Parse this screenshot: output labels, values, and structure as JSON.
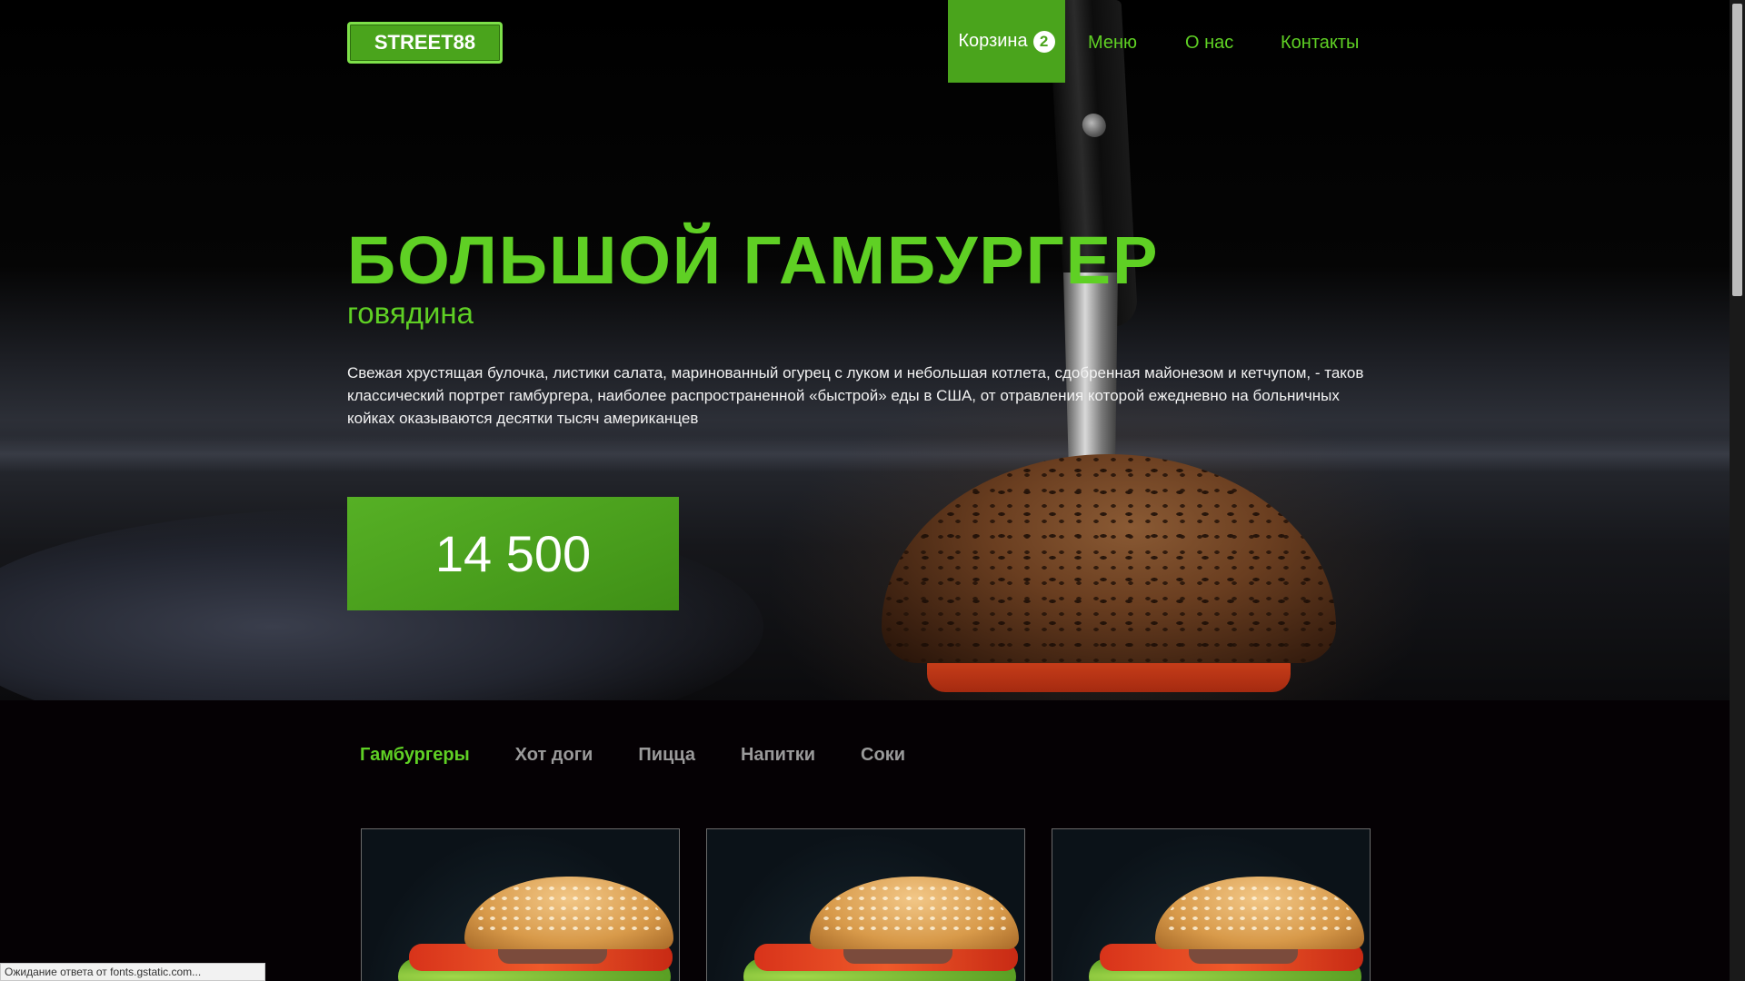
{
  "brand": {
    "logo_text": "STREET88"
  },
  "nav": {
    "cart_label": "Корзина",
    "cart_count": "2",
    "links": [
      "Меню",
      "О нас",
      "Контакты"
    ]
  },
  "hero": {
    "title": "БОЛЬШОЙ ГАМБУРГЕР",
    "subtitle": "говядина",
    "description": "Свежая хрустящая булочка, листики салата, маринованный огурец с луком и небольшая котлета, сдобренная майонезом и кетчупом, - таков классический портрет гамбургера, наиболее распространенной «быстрой» еды в США, от отравления которой ежедневно на больничных койках оказываются десятки тысяч американцев",
    "price": "14 500"
  },
  "categories": [
    "Гамбургеры",
    "Хот доги",
    "Пицца",
    "Напитки",
    "Соки"
  ],
  "active_category": "Гамбургеры",
  "status_bar": {
    "text": "Ожидание ответа от fonts.gstatic.com..."
  },
  "colors": {
    "accent": "#4aa41c",
    "accent_text": "#5fd024",
    "background": "#050104"
  }
}
